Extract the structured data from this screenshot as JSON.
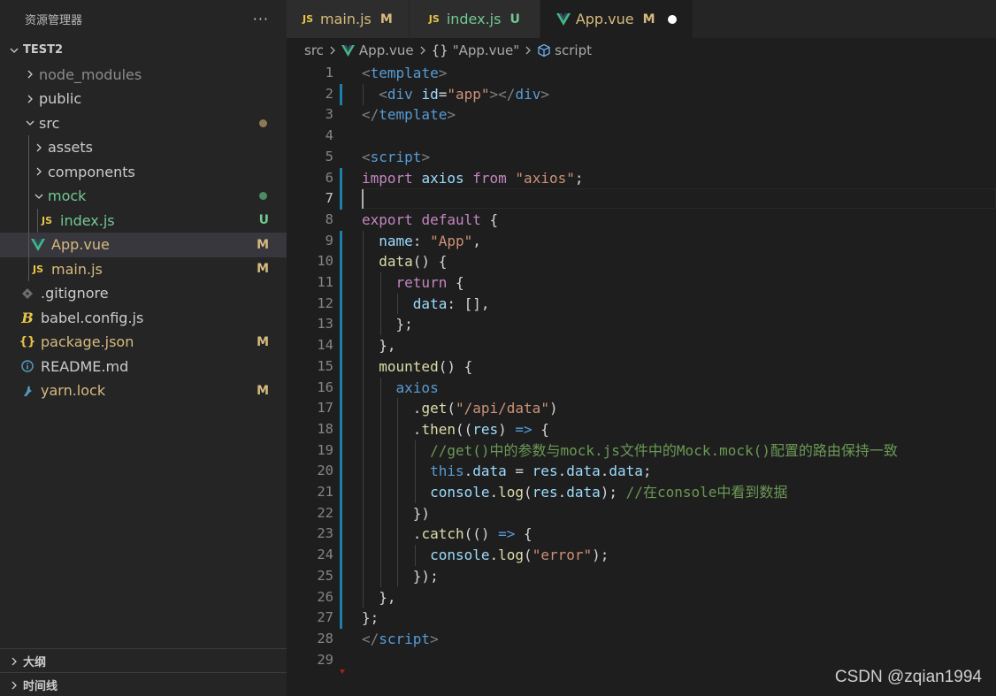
{
  "sidebar": {
    "title": "资源管理器",
    "more": "···",
    "project": "TEST2",
    "tree": [
      {
        "name": "node_modules",
        "status": "",
        "kind": "folder"
      },
      {
        "name": "public",
        "status": "",
        "kind": "folder"
      },
      {
        "name": "src",
        "status": "dot",
        "kind": "folder"
      },
      {
        "name": "assets",
        "status": "",
        "kind": "folder"
      },
      {
        "name": "components",
        "status": "",
        "kind": "folder"
      },
      {
        "name": "mock",
        "status": "dot",
        "kind": "folder"
      },
      {
        "name": "index.js",
        "status": "U",
        "kind": "js"
      },
      {
        "name": "App.vue",
        "status": "M",
        "kind": "vue"
      },
      {
        "name": "main.js",
        "status": "M",
        "kind": "js"
      },
      {
        "name": ".gitignore",
        "status": "",
        "kind": "git"
      },
      {
        "name": "babel.config.js",
        "status": "",
        "kind": "babel"
      },
      {
        "name": "package.json",
        "status": "M",
        "kind": "json"
      },
      {
        "name": "README.md",
        "status": "",
        "kind": "info"
      },
      {
        "name": "yarn.lock",
        "status": "M",
        "kind": "yarn"
      }
    ],
    "outline": "大纲",
    "timeline": "时间线"
  },
  "tabs": [
    {
      "icon": "JS",
      "label": "main.js",
      "status": "M"
    },
    {
      "icon": "JS",
      "label": "index.js",
      "status": "U"
    },
    {
      "icon": "vue",
      "label": "App.vue",
      "status": "M"
    }
  ],
  "breadcrumb": {
    "folder": "src",
    "file": "App.vue",
    "braces": "{}",
    "component": "\"App.vue\"",
    "symbol": "script"
  },
  "line_numbers": [
    "1",
    "2",
    "3",
    "4",
    "5",
    "6",
    "7",
    "8",
    "9",
    "10",
    "11",
    "12",
    "13",
    "14",
    "15",
    "16",
    "17",
    "18",
    "19",
    "20",
    "21",
    "22",
    "23",
    "24",
    "25",
    "26",
    "27",
    "28",
    "29"
  ],
  "code": {
    "l1": [
      "<",
      "template",
      ">"
    ],
    "l2": [
      "  ",
      "<",
      "div",
      " ",
      "id",
      "=",
      "\"app\"",
      "></",
      "div",
      ">"
    ],
    "l3": [
      "</",
      "template",
      ">"
    ],
    "l5": [
      "<",
      "script",
      ">"
    ],
    "l6": [
      "import",
      " ",
      "axios",
      " ",
      "from",
      " ",
      "\"axios\"",
      ";"
    ],
    "l8": [
      "export",
      " ",
      "default",
      " {"
    ],
    "l9": [
      "  ",
      "name",
      ": ",
      "\"App\"",
      ","
    ],
    "l10": [
      "  ",
      "data",
      "() {"
    ],
    "l11": [
      "    ",
      "return",
      " {"
    ],
    "l12": [
      "      ",
      "data",
      ": [],"
    ],
    "l13": [
      "    };"
    ],
    "l14": [
      "  },"
    ],
    "l15": [
      "  ",
      "mounted",
      "() {"
    ],
    "l16": [
      "    ",
      "axios"
    ],
    "l17": [
      "      .",
      "get",
      "(",
      "\"/api/data\"",
      ")"
    ],
    "l18": [
      "      .",
      "then",
      "((",
      "res",
      ") ",
      "=>",
      " {"
    ],
    "l19": [
      "        ",
      "//get()中的参数与mock.js文件中的Mock.mock()配置的路由保持一致"
    ],
    "l20": [
      "        ",
      "this",
      ".",
      "data",
      " = ",
      "res",
      ".",
      "data",
      ".",
      "data",
      ";"
    ],
    "l21": [
      "        ",
      "console",
      ".",
      "log",
      "(",
      "res",
      ".",
      "data",
      "); ",
      "//在console中看到数据"
    ],
    "l22": [
      "      })"
    ],
    "l23": [
      "      .",
      "catch",
      "(() ",
      "=>",
      " {"
    ],
    "l24": [
      "        ",
      "console",
      ".",
      "log",
      "(",
      "\"error\"",
      ");"
    ],
    "l25": [
      "      });"
    ],
    "l26": [
      "  },"
    ],
    "l27": [
      "};"
    ],
    "l28": [
      "</",
      "script",
      ">"
    ]
  },
  "watermark": "CSDN @zqian1994",
  "colors": {
    "modified": "#d7ba7d",
    "untracked": "#73c991",
    "vue": "#41b883",
    "js": "#e8c547"
  }
}
